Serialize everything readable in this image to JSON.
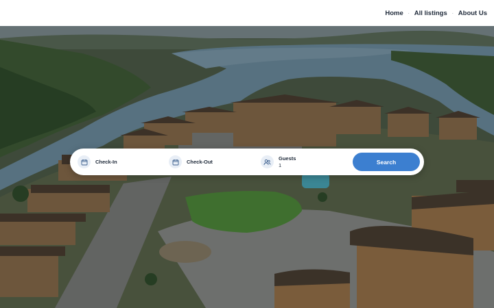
{
  "header": {
    "nav": [
      {
        "label": "Home"
      },
      {
        "label": "All listings"
      },
      {
        "label": "About Us"
      }
    ],
    "separator": "·"
  },
  "search": {
    "checkin": {
      "label": "Check-In",
      "icon": "calendar-icon"
    },
    "checkout": {
      "label": "Check-Out",
      "icon": "calendar-icon"
    },
    "guests": {
      "label": "Guests",
      "value": "1",
      "icon": "users-icon"
    },
    "button_label": "Search",
    "accent": "#3c7fd0"
  },
  "hero": {
    "description_icon": "resort-lake-aerial-image"
  }
}
